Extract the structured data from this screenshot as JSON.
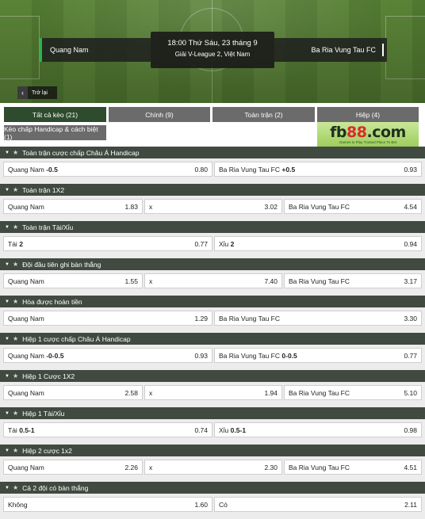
{
  "header": {
    "home_team": "Quang Nam",
    "away_team": "Ba Ria Vung Tau FC",
    "kickoff": "18:00 Thứ Sáu, 23 tháng 9",
    "league": "Giải V-League 2, Việt Nam",
    "back_label": "Trở lại"
  },
  "tabs": [
    {
      "label": "Tất cả kèo (21)",
      "active": true
    },
    {
      "label": "Chính (9)"
    },
    {
      "label": "Toàn trận (2)"
    },
    {
      "label": "Hiệp (4)"
    },
    {
      "label": "Kèo chấp Handicap & cách biệt (1)"
    }
  ],
  "logo": {
    "text_main": "fb",
    "text_accent": "88",
    "text_suffix": ".com",
    "tagline": "Games to Play  Trusted Place To Bet"
  },
  "markets": [
    {
      "title": "Toàn trận cược chấp Châu Á Handicap",
      "layout": 2,
      "cells": [
        {
          "label": "Quang Nam",
          "line": "-0.5",
          "odd": "0.80"
        },
        {
          "label": "Ba Ria Vung Tau FC",
          "line": "+0.5",
          "odd": "0.93"
        }
      ]
    },
    {
      "title": "Toàn trận 1X2",
      "layout": 3,
      "cells": [
        {
          "label": "Quang Nam",
          "odd": "1.83"
        },
        {
          "label": "x",
          "odd": "3.02"
        },
        {
          "label": "Ba Ria Vung Tau FC",
          "odd": "4.54"
        }
      ]
    },
    {
      "title": "Toàn trận Tài/Xỉu",
      "layout": 2,
      "cells": [
        {
          "label": "Tài",
          "line": "2",
          "odd": "0.77"
        },
        {
          "label": "Xỉu",
          "line": "2",
          "odd": "0.94"
        }
      ]
    },
    {
      "title": "Đội đầu tiên ghi bàn thắng",
      "layout": 3,
      "cells": [
        {
          "label": "Quang Nam",
          "odd": "1.55"
        },
        {
          "label": "x",
          "odd": "7.40"
        },
        {
          "label": "Ba Ria Vung Tau FC",
          "odd": "3.17"
        }
      ]
    },
    {
      "title": "Hòa được hoàn tiền",
      "layout": 2,
      "cells": [
        {
          "label": "Quang Nam",
          "odd": "1.29"
        },
        {
          "label": "Ba Ria Vung Tau FC",
          "odd": "3.30"
        }
      ]
    },
    {
      "title": "Hiệp 1 cược chấp Châu Á Handicap",
      "layout": 2,
      "cells": [
        {
          "label": "Quang Nam",
          "line": "-0-0.5",
          "odd": "0.93"
        },
        {
          "label": "Ba Ria Vung Tau FC",
          "line": "0-0.5",
          "odd": "0.77"
        }
      ]
    },
    {
      "title": "Hiệp 1 Cược 1X2",
      "layout": 3,
      "cells": [
        {
          "label": "Quang Nam",
          "odd": "2.58"
        },
        {
          "label": "x",
          "odd": "1.94"
        },
        {
          "label": "Ba Ria Vung Tau FC",
          "odd": "5.10"
        }
      ]
    },
    {
      "title": "Hiệp 1 Tài/Xỉu",
      "layout": 2,
      "cells": [
        {
          "label": "Tài",
          "line": "0.5-1",
          "odd": "0.74"
        },
        {
          "label": "Xỉu",
          "line": "0.5-1",
          "odd": "0.98"
        }
      ]
    },
    {
      "title": "Hiệp 2 cược 1x2",
      "layout": 3,
      "cells": [
        {
          "label": "Quang Nam",
          "odd": "2.26"
        },
        {
          "label": "x",
          "odd": "2.30"
        },
        {
          "label": "Ba Ria Vung Tau FC",
          "odd": "4.51"
        }
      ]
    },
    {
      "title": "Cả 2 đội có bàn thắng",
      "layout": 2,
      "cells": [
        {
          "label": "Không",
          "odd": "1.60"
        },
        {
          "label": "Có",
          "odd": "2.11"
        }
      ]
    }
  ],
  "icons": {
    "chevron": "chevron-down-icon",
    "star": "star-icon",
    "back": "chevron-left-icon"
  },
  "colors": {
    "accent_green": "#2bb24c",
    "active_tab": "#2e4b2e",
    "tab": "#6b6b6b",
    "market_header": "#414a40"
  }
}
